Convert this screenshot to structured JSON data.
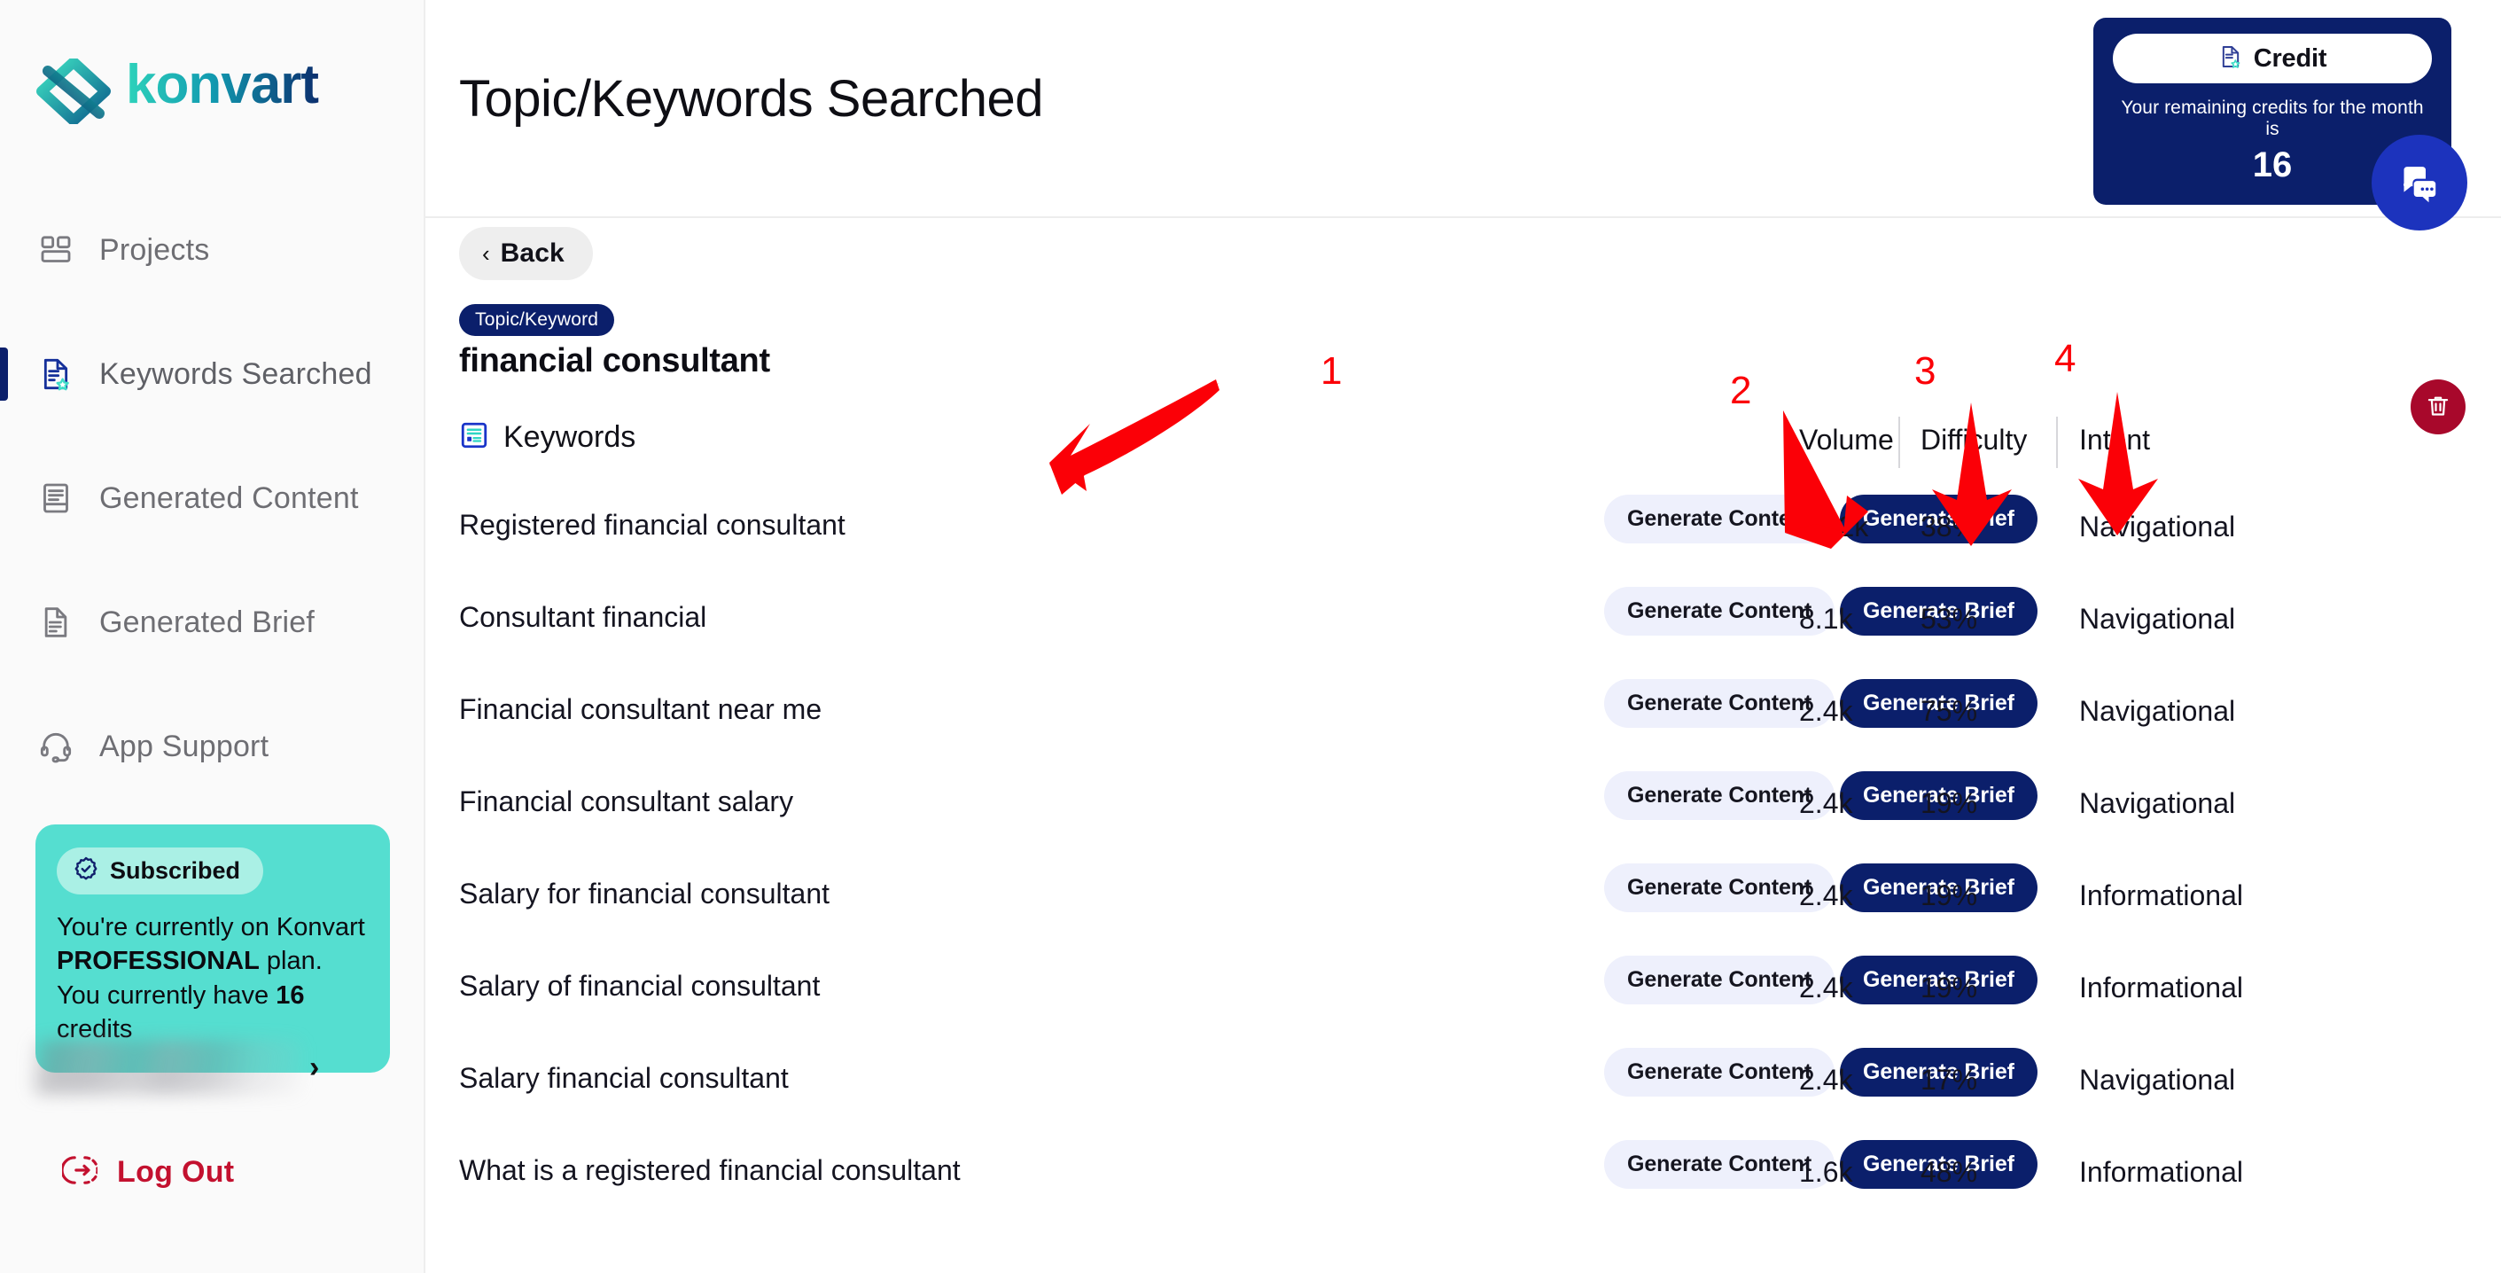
{
  "brand": {
    "name": "konvart",
    "logo_icon": "konvart-logo"
  },
  "sidebar": {
    "items": [
      {
        "label": "Projects",
        "icon": "grid-layout-icon",
        "active": false
      },
      {
        "label": "Keywords Searched",
        "icon": "document-star-icon",
        "active": true
      },
      {
        "label": "Generated Content",
        "icon": "document-lines-icon",
        "active": false
      },
      {
        "label": "Generated Brief",
        "icon": "document-text-icon",
        "active": false
      },
      {
        "label": "App Support",
        "icon": "headset-icon",
        "active": false
      }
    ],
    "subscription": {
      "badge_label": "Subscribed",
      "badge_icon": "verified-check-icon",
      "line1_prefix": "You're currently on Konvart",
      "plan_name": "PROFESSIONAL",
      "line1_suffix": "plan.",
      "line2_prefix": "You currently have",
      "credits": "16",
      "line2_suffix": "credits"
    },
    "account": {
      "chevron_icon": "chevron-right-icon"
    },
    "logout": {
      "label": "Log Out",
      "icon": "logout-icon"
    }
  },
  "header": {
    "title": "Topic/Keywords Searched",
    "credit_card": {
      "pill_label": "Credit",
      "pill_icon": "document-star-icon",
      "description": "Your remaining credits for the month is",
      "amount": "16"
    }
  },
  "content": {
    "back_button": {
      "label": "Back",
      "icon": "chevron-left-icon"
    },
    "topic_badge": "Topic/Keyword",
    "topic_value": "financial consultant",
    "delete_button": {
      "icon": "trash-icon"
    },
    "chat_widget": {
      "icon": "chat-bubbles-icon"
    }
  },
  "table": {
    "columns": {
      "keywords": {
        "label": "Keywords",
        "icon": "keywords-list-icon"
      },
      "volume": "Volume",
      "difficulty": "Difficulty",
      "intent": "Intent"
    },
    "row_actions": {
      "generate_content": "Generate Content",
      "generate_brief": "Generate Brief"
    },
    "rows": [
      {
        "keyword": "Registered financial consultant",
        "volume": "22.2k",
        "difficulty": "38%",
        "intent": "Navigational"
      },
      {
        "keyword": "Consultant financial",
        "volume": "8.1k",
        "difficulty": "53%",
        "intent": "Navigational"
      },
      {
        "keyword": "Financial consultant near me",
        "volume": "2.4k",
        "difficulty": "75%",
        "intent": "Navigational"
      },
      {
        "keyword": "Financial consultant salary",
        "volume": "2.4k",
        "difficulty": "19%",
        "intent": "Navigational"
      },
      {
        "keyword": "Salary for financial consultant",
        "volume": "2.4k",
        "difficulty": "19%",
        "intent": "Informational"
      },
      {
        "keyword": "Salary of financial consultant",
        "volume": "2.4k",
        "difficulty": "19%",
        "intent": "Informational"
      },
      {
        "keyword": "Salary financial consultant",
        "volume": "2.4k",
        "difficulty": "17%",
        "intent": "Navigational"
      },
      {
        "keyword": "What is a registered financial consultant",
        "volume": "1.6k",
        "difficulty": "48%",
        "intent": "Informational"
      }
    ]
  },
  "annotations": [
    {
      "number": "1",
      "target": "keywords-column-header"
    },
    {
      "number": "2",
      "target": "volume-column-header"
    },
    {
      "number": "3",
      "target": "difficulty-column-header"
    },
    {
      "number": "4",
      "target": "intent-column-header"
    }
  ],
  "colors": {
    "brand_navy": "#0b1f6b",
    "brand_teal": "#55ded0",
    "annotation_red": "#fb0007",
    "delete_red": "#a8082b",
    "logout_red": "#c3112f",
    "chat_blue": "#1c33bd"
  }
}
